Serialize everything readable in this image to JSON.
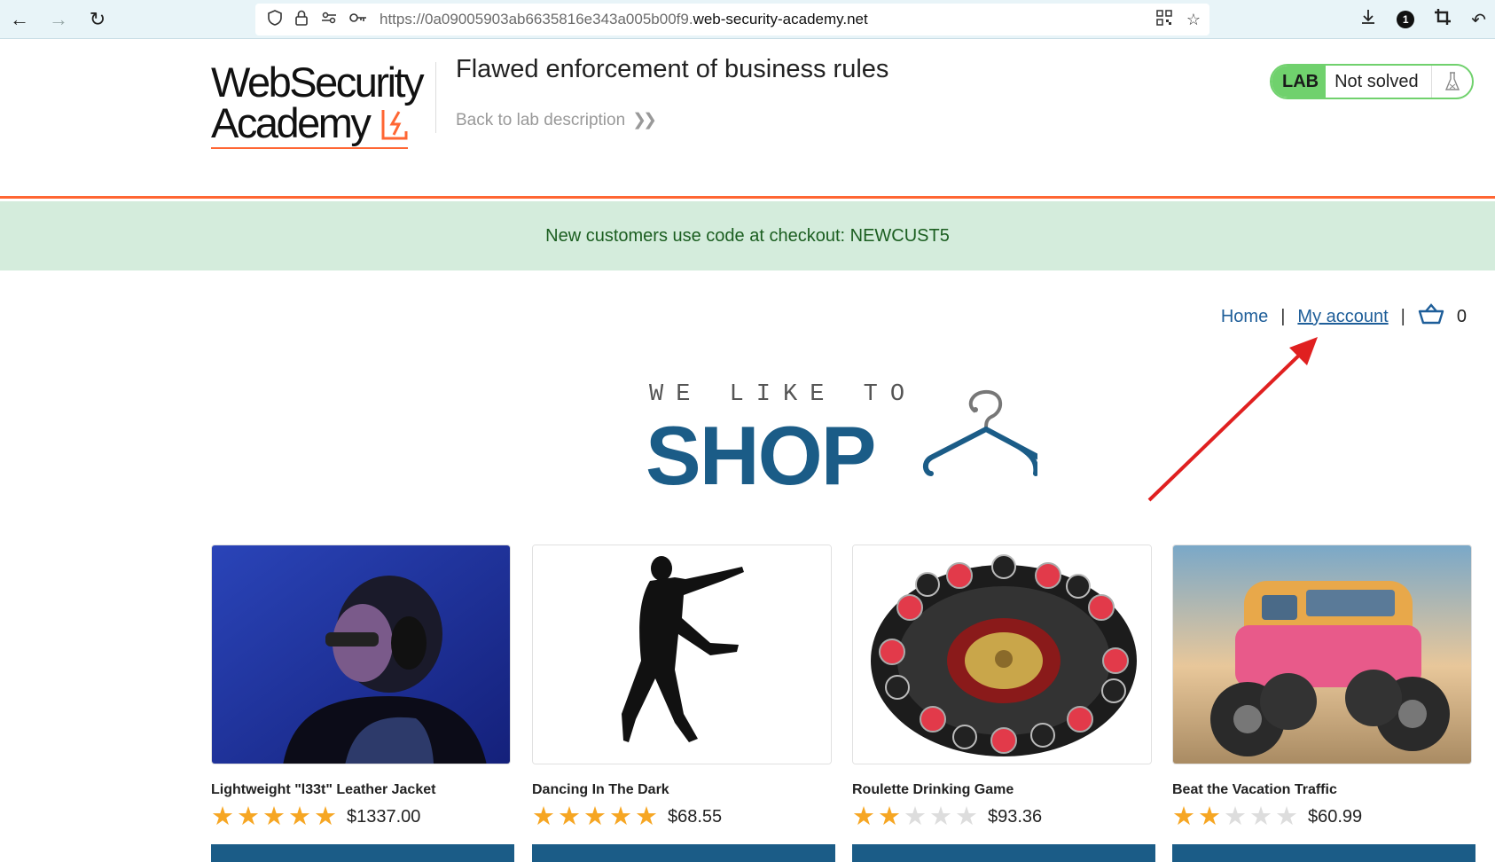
{
  "browser": {
    "url_prefix": "https://0a09005903ab6635816e343a005b00f9.",
    "url_domain": "web-security-academy.net",
    "notification_count": "1"
  },
  "lab": {
    "logo_line1": "WebSecurity",
    "logo_line2": "Academy",
    "title": "Flawed enforcement of business rules",
    "back_link": "Back to lab description",
    "badge": "LAB",
    "status": "Not solved"
  },
  "promo": {
    "text": "New customers use code at checkout: NEWCUST5"
  },
  "nav": {
    "home": "Home",
    "separator": "|",
    "my_account": "My account",
    "cart_count": "0"
  },
  "banner": {
    "tagline": "WE LIKE TO",
    "headline": "SHOP"
  },
  "products": [
    {
      "name": "Lightweight \"l33t\" Leather Jacket",
      "rating": 5,
      "price": "$1337.00",
      "image": "woman-headphones-image"
    },
    {
      "name": "Dancing In The Dark",
      "rating": 5,
      "price": "$68.55",
      "image": "dancer-silhouette-image"
    },
    {
      "name": "Roulette Drinking Game",
      "rating": 2,
      "price": "$93.36",
      "image": "roulette-shot-glasses-image"
    },
    {
      "name": "Beat the Vacation Traffic",
      "rating": 2,
      "price": "$60.99",
      "image": "monster-van-image"
    }
  ],
  "colors": {
    "accent": "#1b5c87",
    "link": "#1e5e99",
    "lab_green": "#70d16d",
    "promo_bg": "#d4ecdc",
    "brand_orange": "#ff6633",
    "star": "#f6a623",
    "annotation_arrow": "#e02020"
  }
}
